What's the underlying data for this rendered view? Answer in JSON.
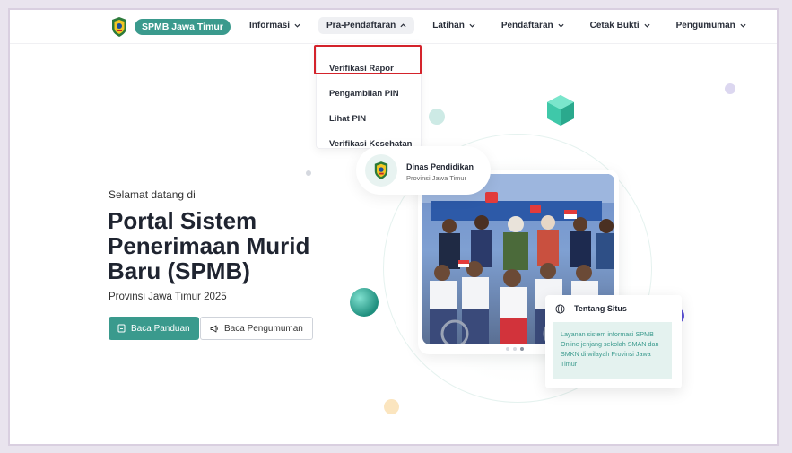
{
  "brand": {
    "name": "SPMB Jawa Timur"
  },
  "nav": {
    "items": [
      {
        "label": "Informasi"
      },
      {
        "label": "Pra-Pendaftaran"
      },
      {
        "label": "Latihan"
      },
      {
        "label": "Pendaftaran"
      },
      {
        "label": "Cetak Bukti"
      },
      {
        "label": "Pengumuman"
      }
    ],
    "dropdown": [
      {
        "label": "Verifikasi Rapor"
      },
      {
        "label": "Pengambilan PIN"
      },
      {
        "label": "Lihat PIN"
      },
      {
        "label": "Verifikasi Kesehatan"
      }
    ]
  },
  "hero": {
    "welcome": "Selamat datang di",
    "title": "Portal Sistem Penerimaan Murid Baru (SPMB)",
    "subtitle": "Provinsi Jawa Timur 2025",
    "primary_button": "Baca Panduan",
    "secondary_button": "Baca Pengumuman"
  },
  "dinas": {
    "title": "Dinas Pendidikan",
    "subtitle": "Provinsi Jawa Timur"
  },
  "about": {
    "title": "Tentang Situs",
    "body": "Layanan sistem informasi SPMB Online jenjang sekolah SMAN dan SMKN di wilayah Provinsi Jawa Timur"
  },
  "colors": {
    "accent": "#3a9a8d",
    "highlight": "#d4232b",
    "background": "#e9e4ee"
  },
  "icons": {
    "crest": "east-java-crest-icon",
    "chevron": "chevron-down-icon",
    "book": "book-icon",
    "megaphone": "megaphone-icon",
    "globe": "globe-icon"
  }
}
